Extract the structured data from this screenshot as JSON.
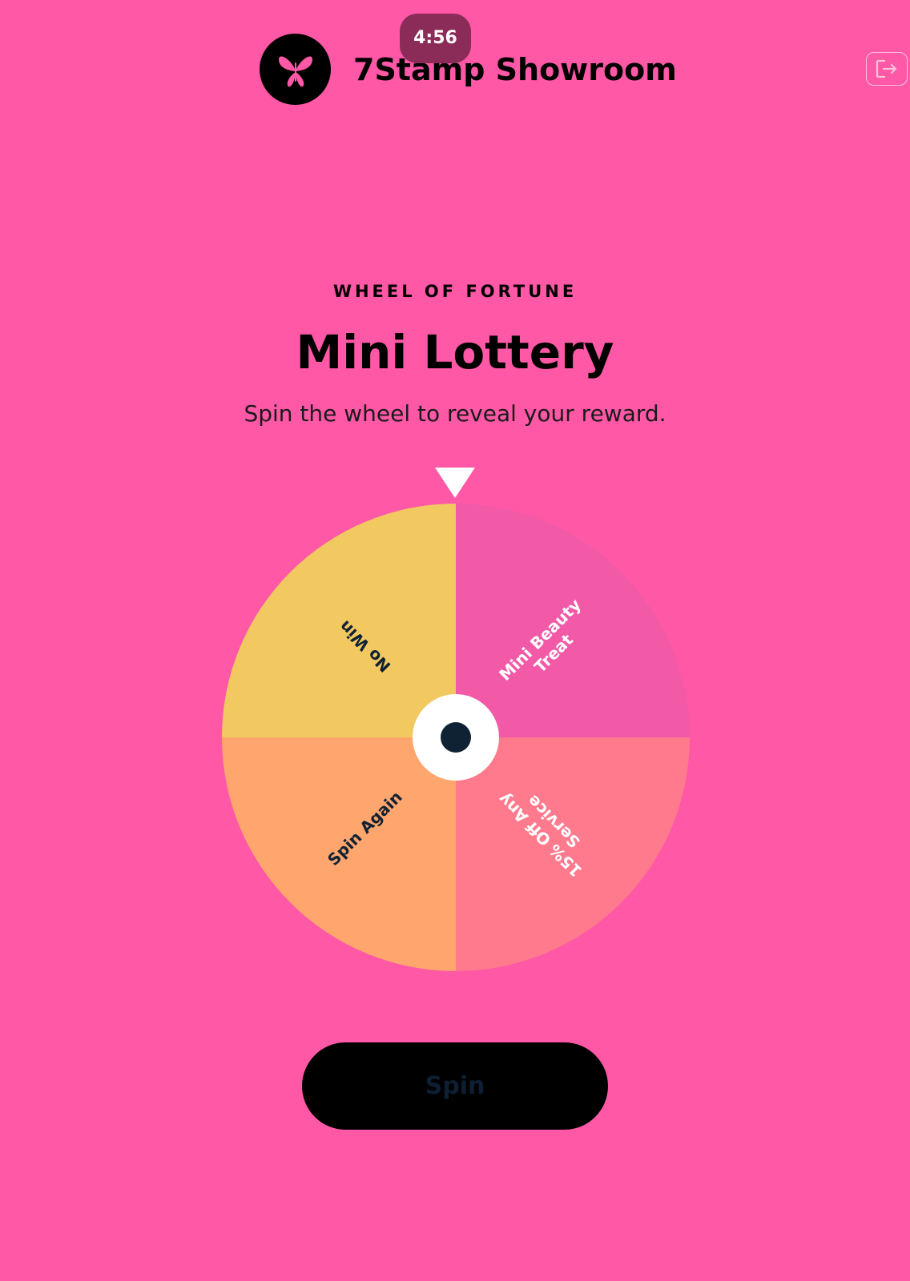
{
  "header": {
    "timer": "4:56",
    "brand_name": "7Stamp Showroom",
    "logo_icon": "butterfly-icon",
    "logout_icon": "logout-icon"
  },
  "game": {
    "eyebrow": "WHEEL OF FORTUNE",
    "title": "Mini Lottery",
    "subtitle": "Spin the wheel to reveal your reward.",
    "segments": [
      {
        "label_lines": [
          "Mini Beauty",
          "Treat"
        ],
        "color": "#F25AA8",
        "text_color": "#FFFFFF"
      },
      {
        "label_lines": [
          "15% Off Any",
          "Service"
        ],
        "color": "#FF7A8C",
        "text_color": "#FFFFFF"
      },
      {
        "label_lines": [
          "Spin Again"
        ],
        "color": "#FFA56E",
        "text_color": "#0F2233"
      },
      {
        "label_lines": [
          "No Win"
        ],
        "color": "#F2C961",
        "text_color": "#0F2233"
      }
    ],
    "spin_label": "Spin"
  },
  "colors": {
    "background": "#FF58A6",
    "timer_badge": "#8B2C58",
    "hub_outer": "#FFFFFF",
    "hub_inner": "#0F2233",
    "spin_button": "#000000"
  }
}
